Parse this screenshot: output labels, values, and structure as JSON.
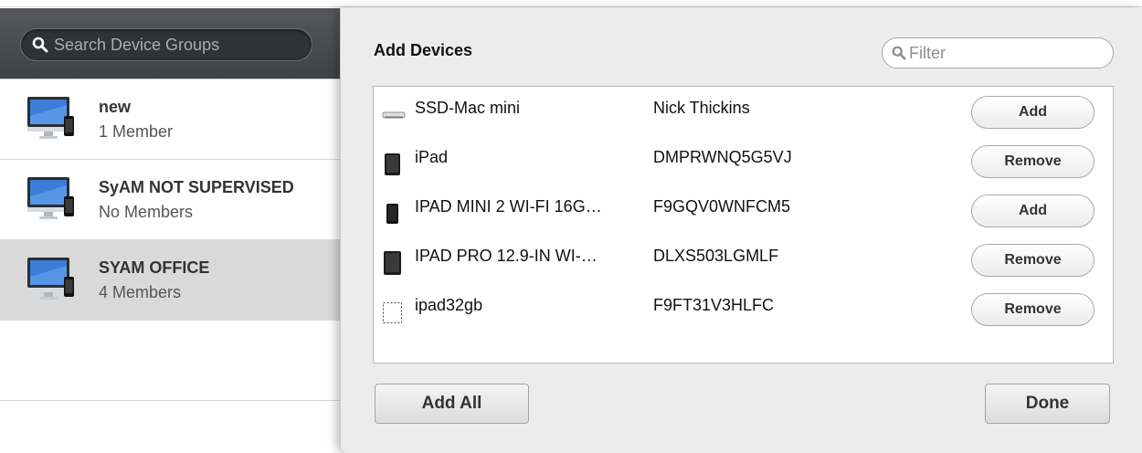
{
  "sidebar": {
    "search_placeholder": "Search Device Groups",
    "groups": [
      {
        "name": "new",
        "count": "1 Member",
        "selected": false,
        "icon": "imac-iphone-icon"
      },
      {
        "name": "SyAM NOT SUPERVISED",
        "count": "No Members",
        "selected": false,
        "icon": "imac-iphone-icon"
      },
      {
        "name": "SYAM OFFICE",
        "count": "4 Members",
        "selected": true,
        "icon": "imac-iphone-icon"
      }
    ]
  },
  "panel": {
    "title": "Add Devices",
    "filter_placeholder": "Filter",
    "devices": [
      {
        "name": "SSD-Mac mini",
        "serial": "Nick Thickins",
        "action": "Add",
        "icon": "mac-mini-icon"
      },
      {
        "name": "iPad",
        "serial": "DMPRWNQ5G5VJ",
        "action": "Remove",
        "icon": "ipad-icon"
      },
      {
        "name": "IPAD MINI 2 WI-FI 16G…",
        "serial": "F9GQV0WNFCM5",
        "action": "Add",
        "icon": "ipad-mini-icon"
      },
      {
        "name": "IPAD PRO 12.9-IN WI-…",
        "serial": "DLXS503LGMLF",
        "action": "Remove",
        "icon": "ipad-pro-icon"
      },
      {
        "name": "ipad32gb",
        "serial": "F9FT31V3HLFC",
        "action": "Remove",
        "icon": "unknown-device-icon"
      }
    ],
    "add_all_label": "Add All",
    "done_label": "Done"
  }
}
